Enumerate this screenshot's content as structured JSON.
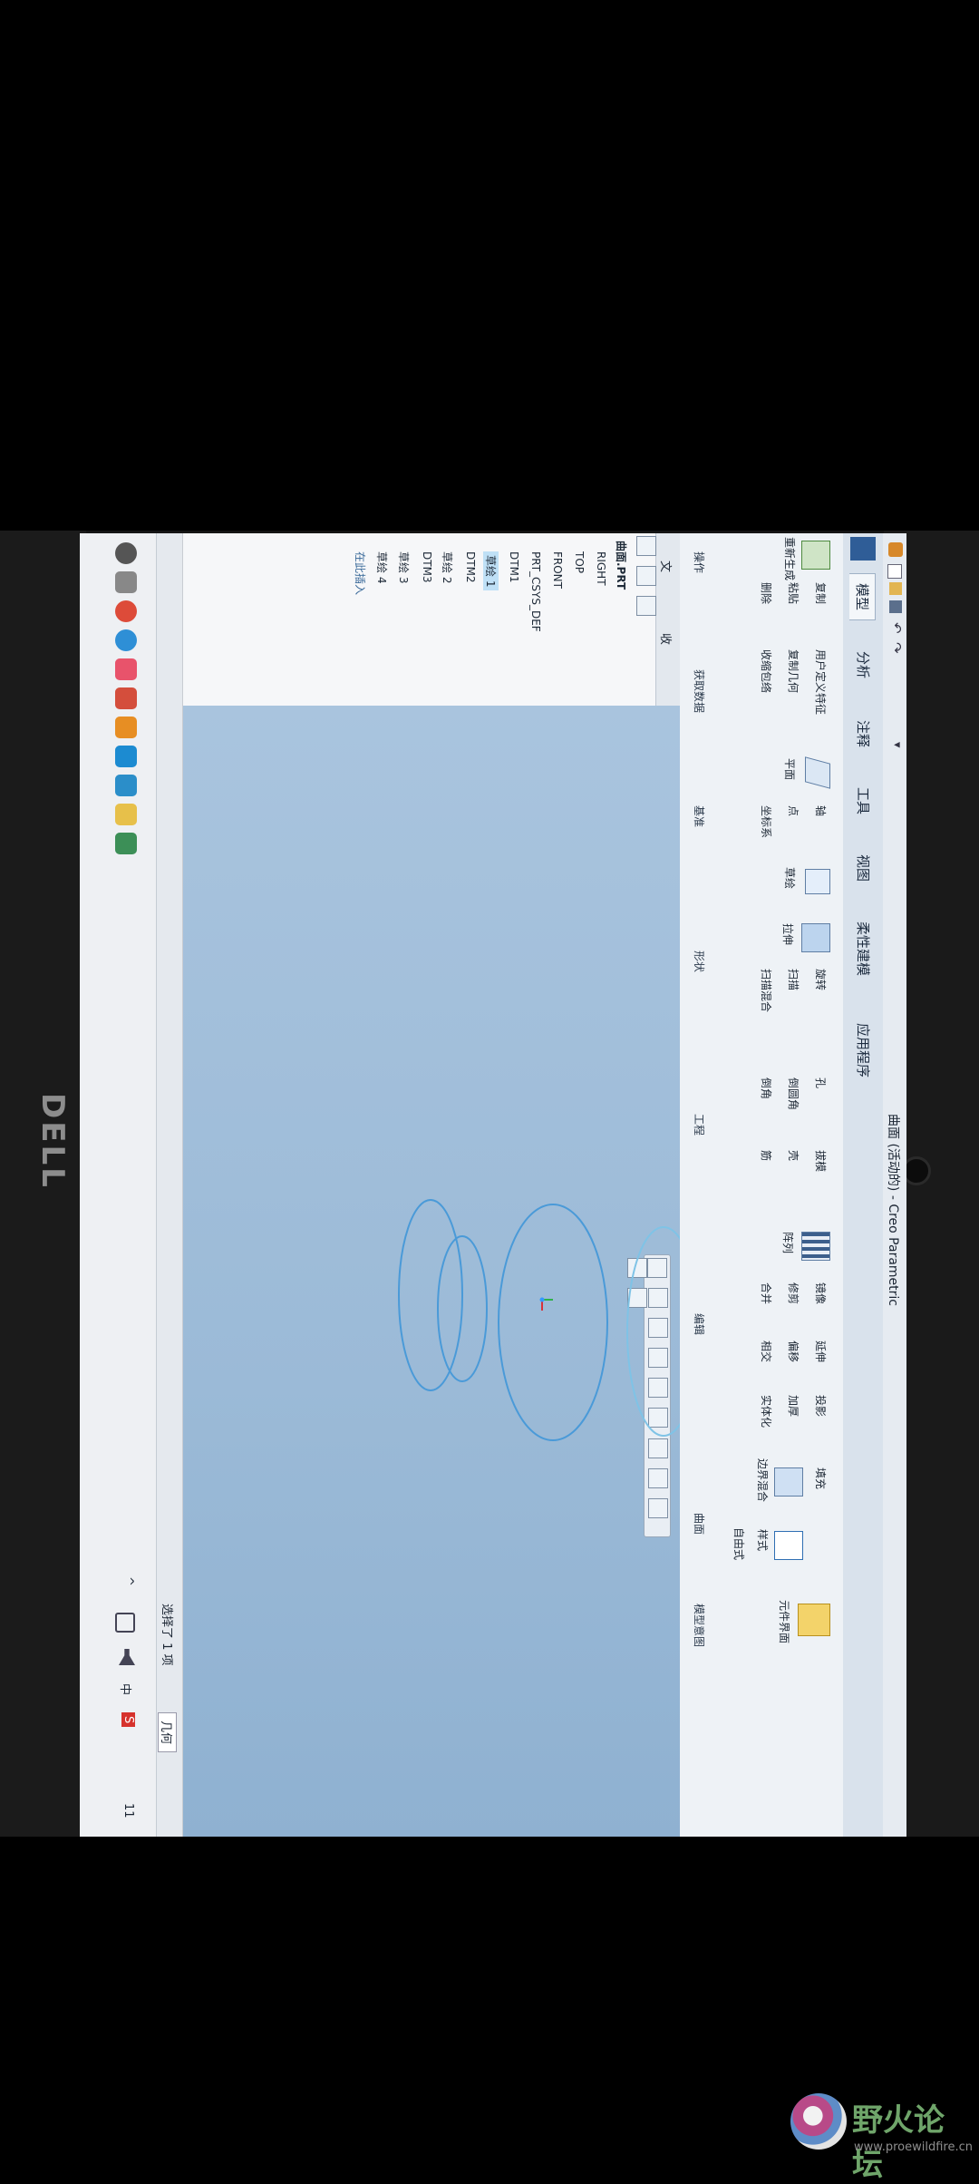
{
  "window": {
    "title": "曲面 (活动的) - Creo Parametric",
    "quick_access": "▾"
  },
  "tabs": [
    {
      "label": "模型"
    },
    {
      "label": "分析"
    },
    {
      "label": "注释"
    },
    {
      "label": "工具"
    },
    {
      "label": "视图"
    },
    {
      "label": "柔性建模"
    },
    {
      "label": "应用程序"
    }
  ],
  "ribbon": {
    "groups": [
      {
        "label": "操作"
      },
      {
        "label": "获取数据"
      },
      {
        "label": "基准"
      },
      {
        "label": "形状"
      },
      {
        "label": "工程"
      },
      {
        "label": "编辑"
      },
      {
        "label": "曲面"
      },
      {
        "label": "模型意图"
      }
    ],
    "buttons": {
      "regen": "重新生成",
      "copy": "复制",
      "paste": "粘贴",
      "delete": "删除",
      "user_defined": "用户定义特征",
      "copy_geom": "复制几何",
      "shrinkwrap": "收缩包络",
      "plane": "平面",
      "axis": "轴",
      "point": "点",
      "csys": "坐标系",
      "sketch": "草绘",
      "extrude": "拉伸",
      "revolve": "旋转",
      "sweep": "扫描",
      "swept_blend": "扫描混合",
      "hole": "孔",
      "round": "倒圆角",
      "chamfer": "倒角",
      "shell": "壳",
      "draft": "拔模",
      "rib": "筋",
      "pattern": "阵列",
      "mirror": "镜像",
      "extend": "延伸",
      "trim": "修剪",
      "offset": "偏移",
      "merge": "合并",
      "intersect": "相交",
      "thicken": "加厚",
      "project": "投影",
      "solidify": "实体化",
      "fill": "填充",
      "boundary_blend": "边界混合",
      "style": "样式",
      "freestyle": "自由式",
      "element_interface": "元件界面"
    }
  },
  "model_tree": {
    "tabs": [
      "文",
      "收"
    ],
    "items": [
      "曲面.PRT",
      "RIGHT",
      "TOP",
      "FRONT",
      "PRT_CSYS_DEF",
      "DTM1",
      "草绘 1",
      "DTM2",
      "草绘 2",
      "DTM3",
      "草绘 3",
      "草绘 4",
      "在此插入"
    ],
    "selected": "草绘 1"
  },
  "status_bar": {
    "selection": "选择了 1 项",
    "filter": "几何"
  },
  "taskbar": {
    "tray": [
      "^",
      "中",
      "S"
    ],
    "time": "11"
  },
  "brand": {
    "bezel_logo": "DELL",
    "watermark_main": "野火论坛",
    "watermark_url": "www.proewildfire.cn"
  },
  "colors": {
    "sketch_curve": "#3d8fd6",
    "viewport": "#a3c1dc",
    "selected_tree": "#bfe0f6"
  }
}
